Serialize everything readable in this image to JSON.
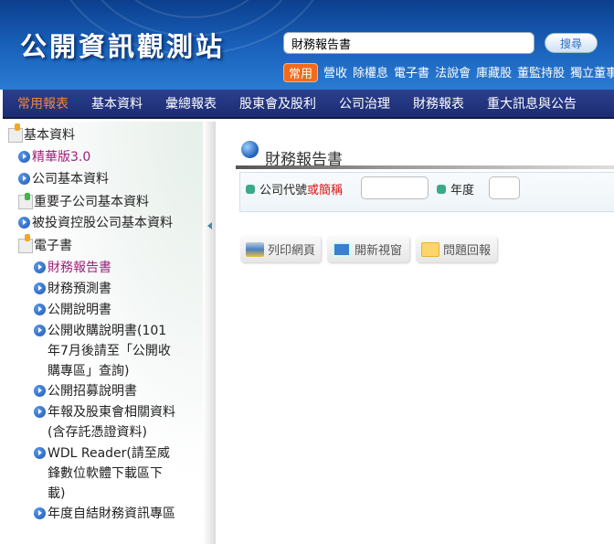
{
  "header": {
    "logo": "公開資訊觀測站",
    "search_value": "財務報告書",
    "search_button": "搜尋",
    "quick_tag": "常用",
    "quick_links": [
      "營收",
      "除權息",
      "電子書",
      "法說會",
      "庫藏股",
      "董監持股",
      "獨立董事"
    ]
  },
  "nav": [
    "常用報表",
    "基本資料",
    "彙總報表",
    "股東會及股利",
    "公司治理",
    "財務報表",
    "重大訊息與公告"
  ],
  "sidebar": {
    "basic": "基本資料",
    "premium": "精華版3.0",
    "company_basic": "公司基本資料",
    "subsidiary": "重要子公司基本資料",
    "invested": "被投資控股公司基本資料",
    "ebook": "電子書",
    "financial_report": "財務報告書",
    "forecast": "財務預測書",
    "prospectus": "公開說明書",
    "acquisition": "公開收購說明書(101年7月後請至「公開收購專區」查詢)",
    "offering": "公開招募說明書",
    "annual": "年報及股東會相關資料(含存託憑證資料)",
    "wdl": "WDL Reader(請至威鋒數位軟體下載區下載)",
    "selfstmt": "年度自結財務資訊專區"
  },
  "main": {
    "title": "財務報告書",
    "company_label": "公司代號",
    "company_label_red": "或簡稱",
    "year_label": "年度",
    "company_value": "",
    "year_value": "",
    "print": "列印網頁",
    "new_window": "開新視窗",
    "feedback": "問題回報"
  }
}
